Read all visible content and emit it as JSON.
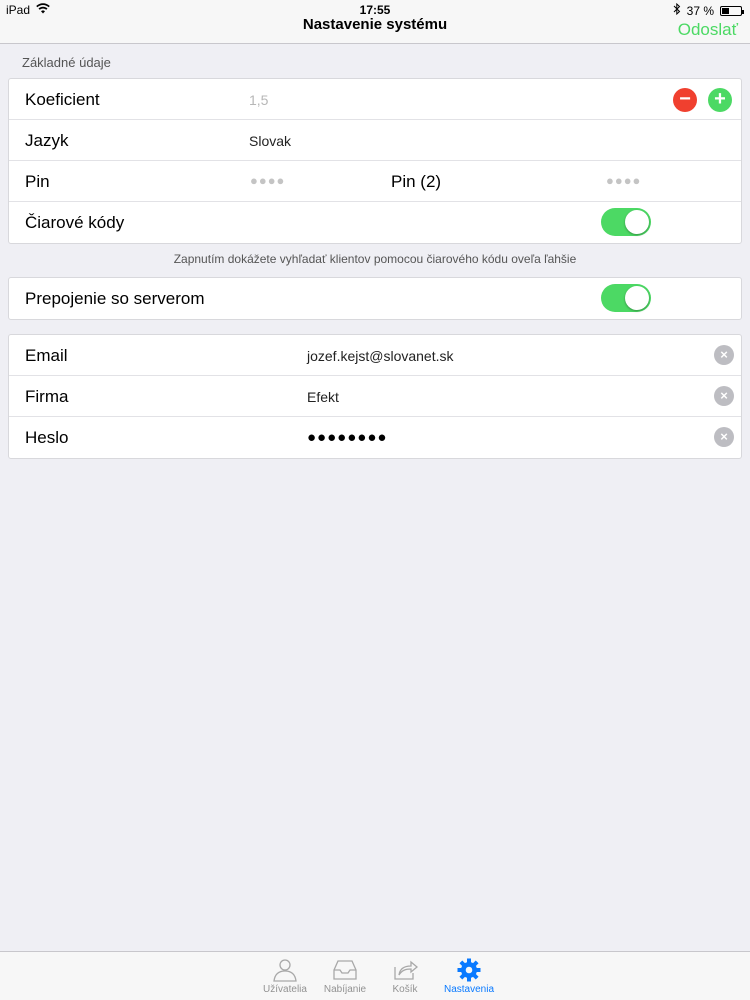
{
  "status_bar": {
    "device": "iPad",
    "time": "17:55",
    "battery": "37 %",
    "battery_level": 0.37
  },
  "nav": {
    "title": "Nastavenie systému",
    "action_label": "Odoslať"
  },
  "section": {
    "header": "Základné údaje"
  },
  "basic": {
    "koeficient_label": "Koeficient",
    "koeficient_value": "1,5",
    "minus_glyph": "−",
    "plus_glyph": "+",
    "jazyk_label": "Jazyk",
    "jazyk_value": "Slovak",
    "pin_label": "Pin",
    "pin_value": "●●●●",
    "pin2_label": "Pin (2)",
    "pin2_value": "●●●●",
    "barcode_label": "Čiarové kódy",
    "barcode_on": true
  },
  "footnote": "Zapnutím dokážete vyhľadať klientov pomocou čiarového kódu oveľa ľahšie",
  "server": {
    "label": "Prepojenie so serverom",
    "on": true
  },
  "account": {
    "email_label": "Email",
    "email_value": "jozef.kejst@slovanet.sk",
    "firma_label": "Firma",
    "firma_value": "Efekt",
    "heslo_label": "Heslo",
    "heslo_value": "●●●●●●●●",
    "clear_glyph": "×"
  },
  "tabs": [
    {
      "label": "Užívatelia",
      "icon": "user-icon"
    },
    {
      "label": "Nabíjanie",
      "icon": "inbox-icon"
    },
    {
      "label": "Košík",
      "icon": "share-tray-icon"
    },
    {
      "label": "Nastavenia",
      "icon": "gear-icon",
      "active": true
    }
  ],
  "colors": {
    "accent_green": "#4cd964",
    "destructive_red": "#f0402f",
    "active_tab_blue": "#0a7aff"
  }
}
